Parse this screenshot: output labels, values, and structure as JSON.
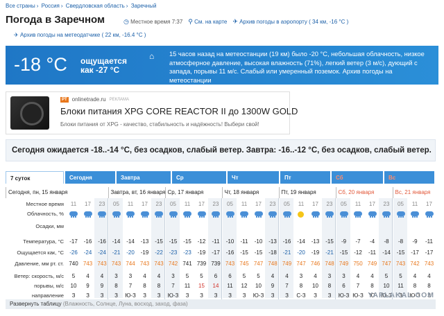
{
  "breadcrumb": [
    "Все страны",
    "Россия",
    "Свердловская область",
    "Заречный"
  ],
  "title": "Погода в Заречном",
  "header": {
    "local_time_label": "Местное время",
    "local_time": "7:37",
    "map_link": "См. на карте",
    "airport_link": "Архив погоды в аэропорту ( 34 км, -16 °C )",
    "station_link": "Архив погоды на метеодатчике ( 22 км, -16.4 °C )"
  },
  "current": {
    "temp": "-18 °C",
    "feels_line1": "ощущается",
    "feels_line2": "как -27 °C",
    "description": "15 часов назад на метеостанции (19 км) было -20 °C, небольшая облачность, низкое атмосферное давление, высокая влажность (71%), легкий ветер (3 м/с), дующий с запада, порывы 11 м/с. Слабый или умеренный поземок. Архив погоды на метеостанции"
  },
  "ad": {
    "source": "onlinetrade.ru",
    "badge": "PT",
    "label": "РЕКЛАМА",
    "headline": "Блоки питания XPG CORE REACTOR II до 1300W GOLD",
    "text": "Блоки питания от XPG - качество, стабильность и надёжность! Выбери свой!"
  },
  "forecast": "Сегодня ожидается -18..-14 °C, без осадков, слабый ветер. Завтра: -16..-12 °C, без осадков, слабый ветер.",
  "tabs": [
    "7 суток",
    "Сегодня",
    "Завтра",
    "Ср",
    "Чт",
    "Пт",
    "Сб",
    "Вс"
  ],
  "days": [
    "Сегодня, пн, 15 января",
    "Завтра, вт, 16 января",
    "Ср, 17 января",
    "Чт, 18 января",
    "Пт, 19 января",
    "Сб, 20 января",
    "Вс, 21 января"
  ],
  "row_labels": {
    "time": "Местное время",
    "cloud": "Облачность, %",
    "precip": "Осадки, мм",
    "temp": "Температура, °C",
    "feels": "Ощущается как, °C",
    "press": "Давление, мм рт. ст.",
    "wind": "Ветер: скорость, м/с",
    "gust": "порывы, м/с",
    "dir": "направление"
  },
  "times": [
    "11",
    "17",
    "23",
    "05",
    "11",
    "17",
    "23",
    "05",
    "11",
    "17",
    "23",
    "05",
    "11",
    "17",
    "23",
    "05",
    "11",
    "17",
    "23",
    "05",
    "11",
    "17",
    "23",
    "05",
    "11",
    "17"
  ],
  "icons": [
    "c",
    "c",
    "c",
    "c",
    "c",
    "c",
    "c",
    "c",
    "c",
    "c",
    "c",
    "c",
    "c",
    "c",
    "c",
    "c",
    "s",
    "c",
    "c",
    "c",
    "c",
    "c",
    "c",
    "c",
    "c",
    "c"
  ],
  "temp": [
    "-17",
    "-16",
    "-16",
    "-14",
    "-14",
    "-13",
    "-15",
    "-15",
    "-15",
    "-12",
    "-11",
    "-10",
    "-11",
    "-10",
    "-13",
    "-16",
    "-14",
    "-13",
    "-15",
    "-9",
    "-7",
    "-4",
    "-8",
    "-8",
    "-9",
    "-11"
  ],
  "feels": [
    "-26",
    "-24",
    "-24",
    "-21",
    "-20",
    "-19",
    "-22",
    "-23",
    "-23",
    "-19",
    "-17",
    "-16",
    "-15",
    "-15",
    "-18",
    "-21",
    "-20",
    "-19",
    "-21",
    "-15",
    "-12",
    "-11",
    "-14",
    "-15",
    "-17",
    "-17"
  ],
  "press": [
    "740",
    "743",
    "743",
    "743",
    "744",
    "743",
    "743",
    "742",
    "741",
    "739",
    "739",
    "743",
    "745",
    "747",
    "748",
    "749",
    "747",
    "746",
    "748",
    "749",
    "750",
    "749",
    "747",
    "743",
    "742",
    "743"
  ],
  "wind": [
    "5",
    "4",
    "4",
    "3",
    "3",
    "4",
    "4",
    "3",
    "5",
    "5",
    "6",
    "6",
    "5",
    "5",
    "4",
    "4",
    "3",
    "4",
    "3",
    "3",
    "4",
    "4",
    "5",
    "5",
    "4",
    "4"
  ],
  "gust": [
    "10",
    "9",
    "9",
    "8",
    "7",
    "8",
    "8",
    "7",
    "11",
    "15",
    "14",
    "11",
    "12",
    "10",
    "9",
    "7",
    "8",
    "10",
    "8",
    "6",
    "7",
    "8",
    "10",
    "11",
    "8",
    "8"
  ],
  "dir": [
    "З",
    "З",
    "З",
    "З",
    "Ю-З",
    "З",
    "З",
    "Ю-З",
    "З",
    "З",
    "З",
    "З",
    "З",
    "Ю-З",
    "З",
    "З",
    "С-З",
    "З",
    "З",
    "Ю-З",
    "Ю-З",
    "Ю",
    "Ю-З",
    "З",
    "Ю-З",
    "З"
  ],
  "expand": "Развернуть таблицу",
  "expand_note": "(Влажность, Солнце, Луна, восход, заход, фаза)",
  "watermark": "YAPLAKAL.COM"
}
